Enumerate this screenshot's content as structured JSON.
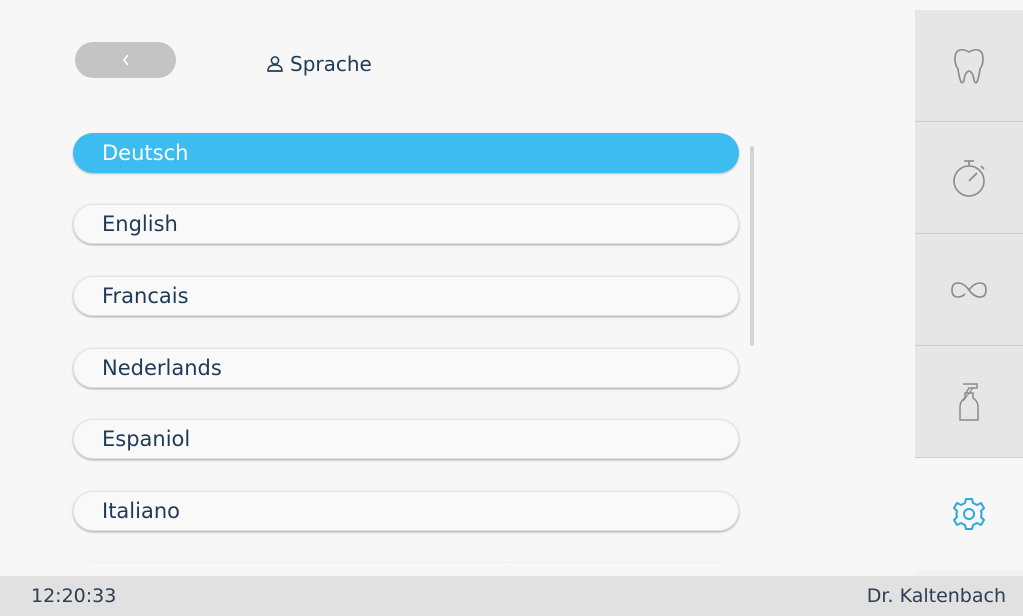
{
  "header": {
    "back_icon": "chevron-left-icon",
    "title_icon": "user-icon",
    "title": "Sprache"
  },
  "languages": {
    "selected": "Deutsch",
    "items": [
      "Deutsch",
      "English",
      "Francais",
      "Nederlands",
      "Espaniol",
      "Italiano"
    ]
  },
  "sidebar": {
    "tabs": [
      {
        "icon": "tooth-icon",
        "active": false
      },
      {
        "icon": "stopwatch-icon",
        "active": false
      },
      {
        "icon": "infinity-icon",
        "active": false
      },
      {
        "icon": "spray-bottle-icon",
        "active": false
      },
      {
        "icon": "gear-icon",
        "active": true
      }
    ]
  },
  "status": {
    "time": "12:20:33",
    "user": "Dr. Kaltenbach"
  },
  "colors": {
    "accent": "#3dbcf0",
    "text": "#1f3a56",
    "icon_gray": "#8a8a8a",
    "active_icon": "#2aa8e0"
  }
}
